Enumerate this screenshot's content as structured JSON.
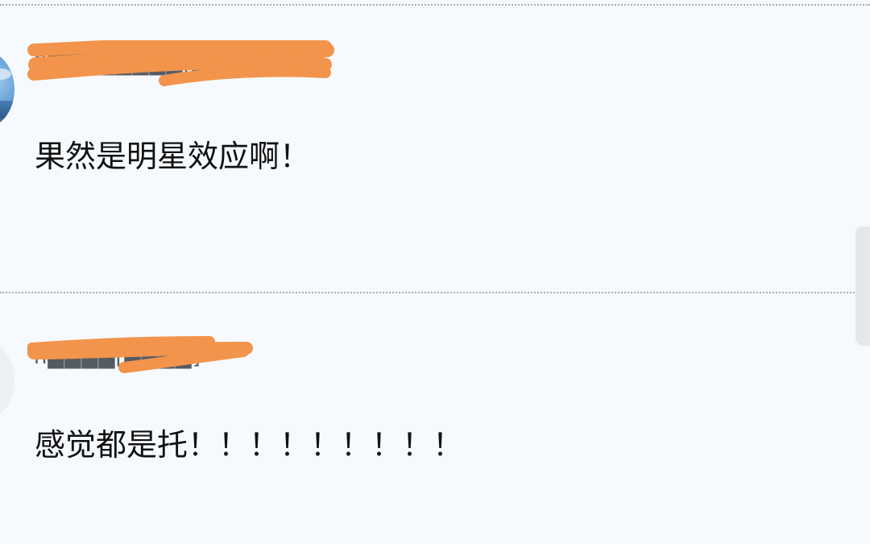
{
  "comments": [
    {
      "username": "S████████[████]",
      "text": "果然是明星效应啊！",
      "avatar_icon": "user-photo-icon",
      "username_redacted": true
    },
    {
      "username": "h████[████]",
      "text": "感觉都是托！！！！！！！！！",
      "avatar_icon": "default-user-icon",
      "username_redacted": true
    }
  ],
  "colors": {
    "background": "#f6fafe",
    "redaction": "#f2944b",
    "text": "#111111",
    "username": "#555b63",
    "divider": "#a8acb0",
    "scrollbar": "#e4e8ec"
  }
}
